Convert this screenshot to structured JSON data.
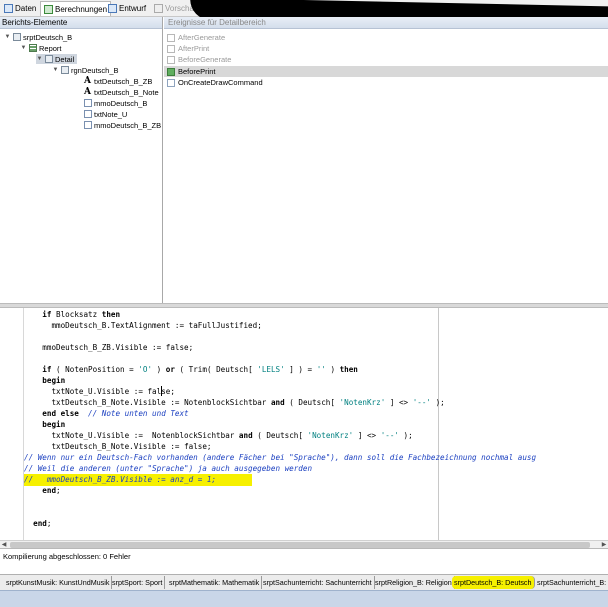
{
  "top_tabs": [
    {
      "label": "Daten",
      "icon": "data-icon",
      "active": false
    },
    {
      "label": "Berechnungen",
      "icon": "calculations-icon",
      "active": true
    },
    {
      "label": "Entwurf",
      "icon": "design-icon",
      "active": false
    },
    {
      "label": "Vorschau",
      "icon": "preview-icon",
      "active": false
    }
  ],
  "report_tree": {
    "header": "Berichts-Elemente",
    "items": [
      {
        "label": "srptDeutsch_B",
        "icon": "subreport-icon",
        "twisty": "▼"
      },
      {
        "label": "Report",
        "icon": "report-icon",
        "twisty": "▼"
      },
      {
        "label": "Detail",
        "icon": "detail-band-icon",
        "twisty": "▼",
        "selected": true
      },
      {
        "label": "rgnDeutsch_B",
        "icon": "region-icon",
        "twisty": "▼"
      },
      {
        "label": "txtDeutsch_B_ZB",
        "icon": "text-icon",
        "glyph": "A"
      },
      {
        "label": "txtDeutsch_B_Note",
        "icon": "text-icon",
        "glyph": "A"
      },
      {
        "label": "mmoDeutsch_B",
        "icon": "memo-icon"
      },
      {
        "label": "txtNote_U",
        "icon": "memo-icon"
      },
      {
        "label": "mmoDeutsch_B_ZB",
        "icon": "memo-icon"
      }
    ]
  },
  "events": {
    "header": "Ereignisse für Detailbereich",
    "items": [
      {
        "label": "AfterGenerate",
        "enabled": false
      },
      {
        "label": "AfterPrint",
        "enabled": false
      },
      {
        "label": "BeforeGenerate",
        "enabled": false
      },
      {
        "label": "BeforePrint",
        "enabled": true,
        "selected": true
      },
      {
        "label": "OnCreateDrawCommand",
        "enabled": true
      }
    ]
  },
  "code_lines": [
    "    if Blocksatz then",
    "      mmoDeutsch_B.TextAlignment := taFullJustified;",
    "",
    "    mmoDeutsch_B_ZB.Visible := false;",
    "",
    "    if ( NotenPosition = 'O' ) or ( Trim( Deutsch[ 'LELS' ] ) = '' ) then",
    "    begin",
    "      txtNote_U.Visible := false;",
    "      txtDeutsch_B_Note.Visible := NotenblockSichtbar and ( Deutsch[ 'NotenKrz' ] <> '--' );",
    "    end else  // Note unten und Text",
    "    begin",
    "      txtNote_U.Visible :=  NotenblockSichtbar and ( Deutsch[ 'NotenKrz' ] <> '--' );",
    "      txtDeutsch_B_Note.Visible := false;",
    "// Wenn nur ein Deutsch-Fach vorhanden (andere Fächer bei \"Sprache\"), dann soll die Fachbezeichnung nochmal ausg",
    "// Weil die anderen (unter \"Sprache\") ja auch ausgegeben werden",
    "//   mmoDeutsch_B_ZB.Visible := anz_d = 1;",
    "    end;",
    "",
    "",
    "  end;"
  ],
  "messages": {
    "text": "Kompilierung abgeschlossen: 0 Fehler"
  },
  "bottom_tabs": [
    {
      "label": "srptKunstMusik: KunstUndMusik",
      "active": false
    },
    {
      "label": "srptSport: Sport",
      "active": false
    },
    {
      "label": "srptMathematik: Mathematik",
      "active": false
    },
    {
      "label": "srptSachunterricht: Sachunterricht",
      "active": false
    },
    {
      "label": "srptReligion_B: Religion",
      "active": false
    },
    {
      "label": "srptDeutsch_B: Deutsch",
      "active": true
    },
    {
      "label": "srptSachunterricht_B:",
      "active": false
    }
  ],
  "colors": {
    "highlight": "#f6f000",
    "comment": "#1a3fc0",
    "string": "#008080",
    "selected_row": "#d8d8d8"
  }
}
